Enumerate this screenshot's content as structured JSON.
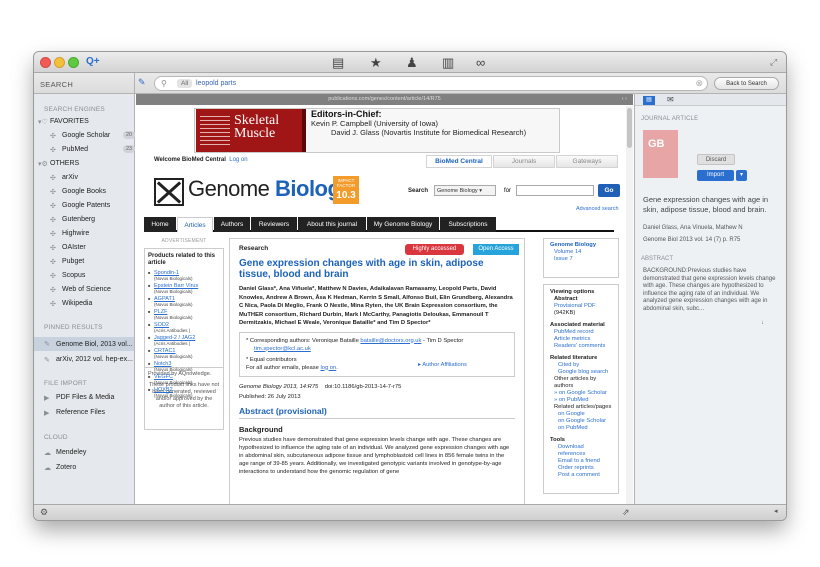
{
  "toolbar": {
    "add_icon": "Q+",
    "center_icons": [
      "list-icon",
      "star-icon",
      "person-icon",
      "books-icon",
      "glasses-icon"
    ],
    "expand_icon": "expand"
  },
  "sidebar": {
    "header": "SEARCH",
    "engines_header": "SEARCH ENGINES",
    "favorites_label": "FAVORITES",
    "favorites": [
      {
        "label": "Google Scholar",
        "count": "20"
      },
      {
        "label": "PubMed",
        "count": "23"
      }
    ],
    "others_label": "OTHERS",
    "others": [
      "arXiv",
      "Google Books",
      "Google Patents",
      "Gutenberg",
      "Highwire",
      "OAIster",
      "Pubget",
      "Scopus",
      "Web of Science",
      "Wikipedia"
    ],
    "pinned_header": "PINNED RESULTS",
    "pinned": [
      "Genome Biol, 2013 vol...",
      "arXiv, 2012 vol. hep-ex..."
    ],
    "file_import_header": "FILE IMPORT",
    "file_import": [
      "PDF Files & Media",
      "Reference Files"
    ],
    "cloud_header": "CLOUD",
    "cloud": [
      "Mendeley",
      "Zotero"
    ]
  },
  "search": {
    "scope": "All",
    "query": "leopold parts",
    "back_label": "Back to Search"
  },
  "browser": {
    "url": "publications.com/genes/content/article/14/R75",
    "ad": {
      "journal": "Skeletal Muscle",
      "editors_head": "Editors-in-Chief:",
      "editor1": "Kevin P. Campbell (University of Iowa)",
      "editor2": "David J. Glass (Novartis Institute for Biomedical Research)"
    },
    "welcome": "Welcome BioMed Central",
    "login": "Log on",
    "bmc_tabs": [
      "BioMed Central",
      "Journals",
      "Gateways"
    ],
    "journal_name_1": "Genome ",
    "journal_name_2": "Biology",
    "impact_label": "IMPACT FACTOR",
    "impact_value": "10.3",
    "search_label": "Search",
    "search_scope": "Genome Biology",
    "for_label": "for",
    "go": "Go",
    "advanced_search": "Advanced search",
    "nav_tabs": [
      "Home",
      "Articles",
      "Authors",
      "Reviewers",
      "About this journal",
      "My Genome Biology",
      "Subscriptions"
    ],
    "left": {
      "advert": "ADVERTISEMENT",
      "products_head": "Products related to this article",
      "products": [
        {
          "name": "Spondin-1",
          "src": "(Novus Biologicals)"
        },
        {
          "name": "Epstein Barr Virus",
          "src": "(Novus Biologicals)"
        },
        {
          "name": "AGPAT1",
          "src": "(Novus Biologicals)"
        },
        {
          "name": "PLZF",
          "src": "(Novus Biologicals)"
        },
        {
          "name": "SOD2",
          "src": "(Acris Antibodies )"
        },
        {
          "name": "Jagged-2 / JAG2",
          "src": "(Acris Antibodies )"
        },
        {
          "name": "CRTAC1",
          "src": "(Novus Biologicals)"
        },
        {
          "name": "Notch3",
          "src": "(Novus Biologicals)"
        },
        {
          "name": "VEGFC",
          "src": "(Novus Biologicals)"
        },
        {
          "name": "HOXB2",
          "src": "(Novus Biologicals)"
        }
      ],
      "provided_by": "Provided by AQnowledge.",
      "disclaimer": "These product links have not been generated, reviewed and/or approved by the author of this article."
    },
    "article": {
      "type": "Research",
      "badge_high": "Highly accessed",
      "badge_open": "Open Access",
      "title": "Gene expression changes with age in skin, adipose tissue, blood and brain",
      "authors": "Daniel Glass*, Ana Viñuela*, Matthew N Davies, Adaikalavan Ramasamy, Leopold Parts, David Knowles, Andrew A Brown, Åsa K Hedman, Kerrin S Small, Alfonso Buil, Elin Grundberg, Alexandra C Nica, Paola Di Meglio, Frank O Nestle, Mina Ryten, the UK Brain Expression consortium, the MuTHER consortium, Richard Durbin, Mark I McCarthy, Panagiotis Deloukas, Emmanouil T Dermitzakis, Michael E Weale, Veronique Bataille* and Tim D Spector*",
      "corr": "* Corresponding authors: Veronique Bataille",
      "corr_email1": "bataille@doctors.org.uk",
      "corr_mid": "- Tim D Spector",
      "corr_email2": "tim.spector@kcl.ac.uk",
      "equal": "* Equal contributors",
      "all_emails": "For all author emails, please",
      "log_on": "log on",
      "affiliations": "Author Affiliations",
      "citation": "Genome Biology 2013, 14:R75",
      "doi": "doi:10.1186/gb-2013-14-7-r75",
      "published": "Published: 26 July 2013",
      "abstract_head": "Abstract (provisional)",
      "background_head": "Background",
      "background_text": "Previous studies have demonstrated that gene expression levels change with age. These changes are hypothesized to influence the aging rate of an individual. We analyzed gene expression changes with age in abdominal skin, subcutaneous adipose tissue and lymphoblastoid cell lines in 856 female twins in the age range of 39-85 years. Additionally, we investigated genotypic variants involved in genotype-by-age interactions to understand how the genomic regulation of gene"
    },
    "right": {
      "journal": "Genome Biology",
      "volume": "Volume 14",
      "issue": "Issue 7",
      "viewing_head": "Viewing options",
      "viewing": [
        {
          "t": "Abstract",
          "link": false
        },
        {
          "t": "Provisional PDF",
          "link": true
        },
        {
          "t": "(942KB)",
          "link": false
        }
      ],
      "assoc_head": "Associated material",
      "assoc": [
        "PubMed record",
        "Article metrics",
        "Readers' comments"
      ],
      "related_head": "Related literature",
      "related": [
        {
          "t": "Cited by",
          "link": true
        },
        {
          "t": "Google blog search",
          "link": true
        },
        {
          "t": "Other articles by authors",
          "link": false
        },
        {
          "t": "» on Google Scholar",
          "link": true
        },
        {
          "t": "» on PubMed",
          "link": true
        },
        {
          "t": "Related articles/pages",
          "link": false
        },
        {
          "t": "on Google",
          "link": true
        },
        {
          "t": "on Google Scholar",
          "link": true
        },
        {
          "t": "on PubMed",
          "link": true
        }
      ],
      "tools_head": "Tools",
      "tools": [
        "Download references",
        "Email to a friend",
        "Order reprints",
        "Post a comment"
      ]
    }
  },
  "detail": {
    "tag": "JOURNAL ARTICLE",
    "thumb": "GB",
    "discard": "Discard",
    "import": "Import",
    "title": "Gene expression changes with age in skin, adipose tissue, blood and brain.",
    "authors": "Daniel Glass, Ana Vinuela, Mathew N",
    "citation": "Genome Biol 2013 vol. 14 (7) p. R75",
    "abstract_tag": "ABSTRACT",
    "abstract": "BACKGROUND:Previous studies have demonstrated that gene expression levels change with age. These changes are hypothesized to influence the aging rate of an individual. We analyzed gene expression changes with age in abdominal skin, subc...",
    "more": "↓"
  }
}
